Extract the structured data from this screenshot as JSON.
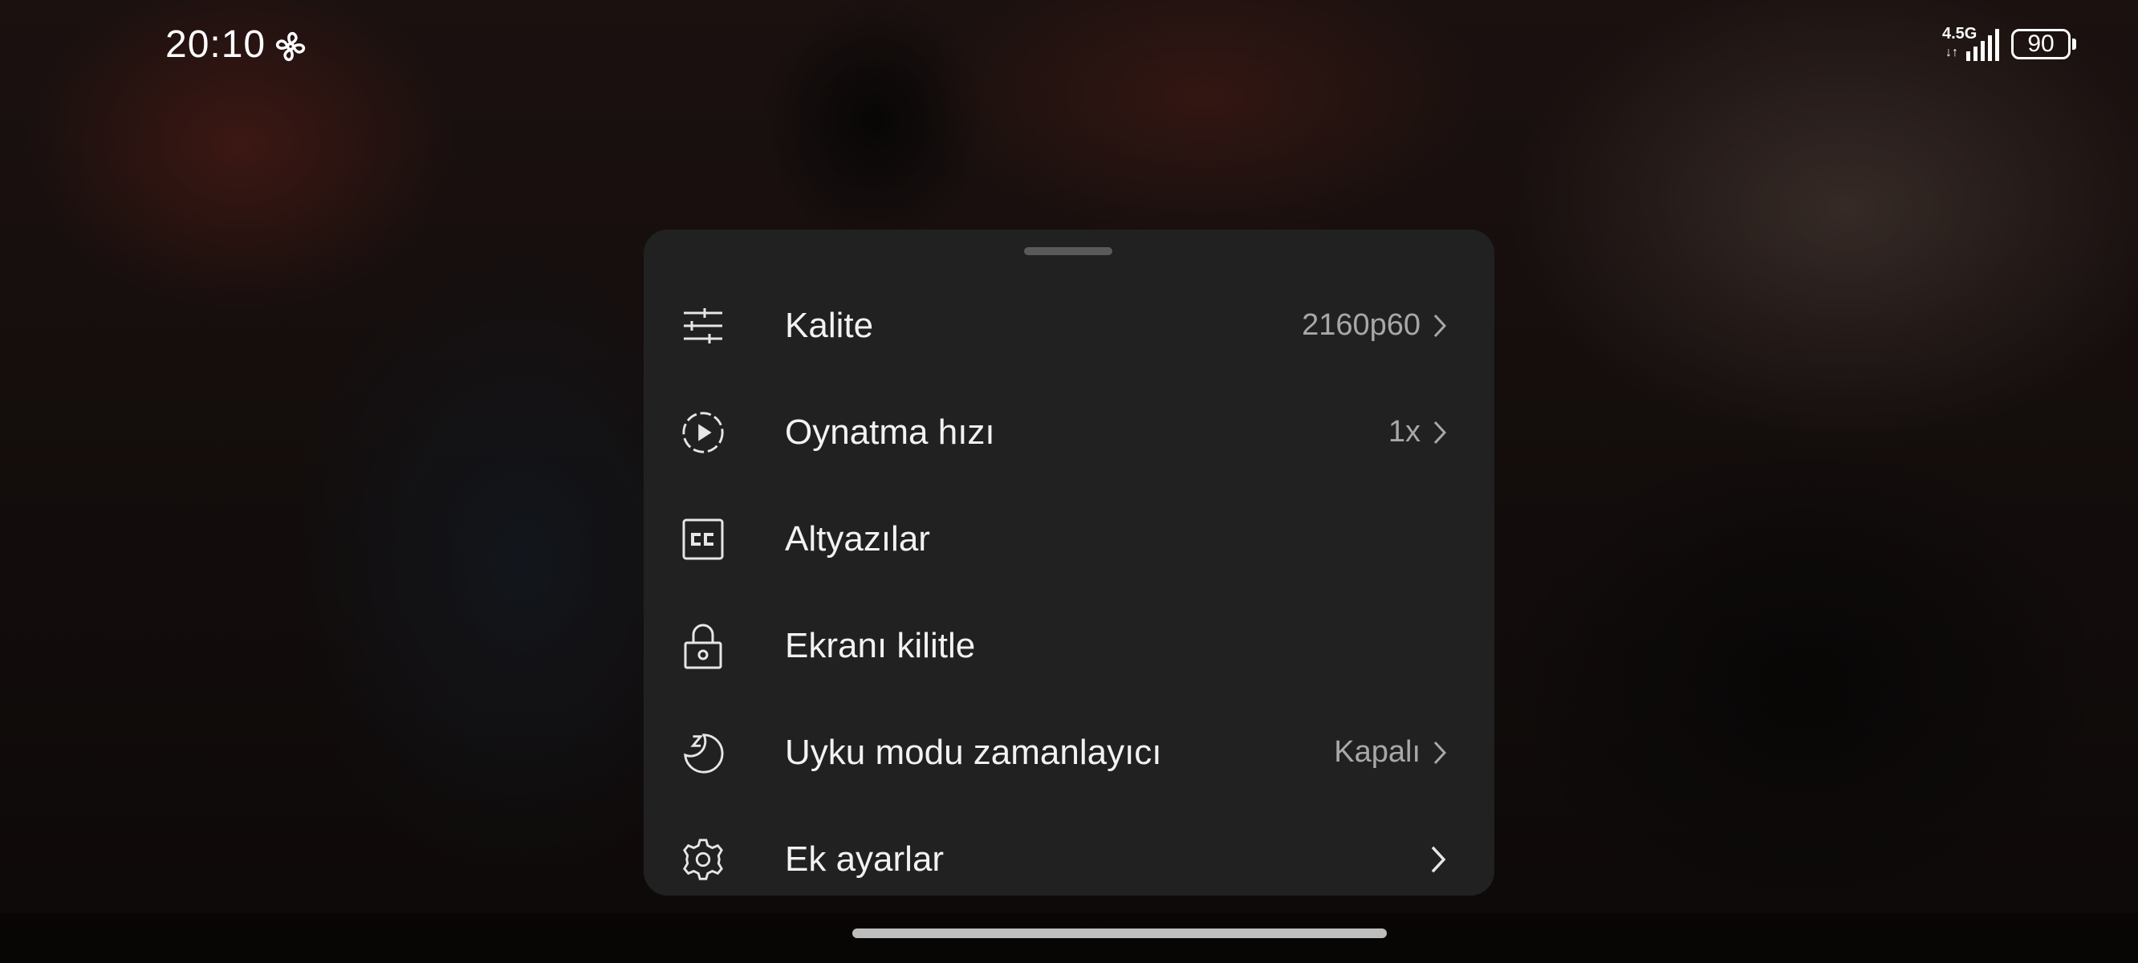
{
  "status_bar": {
    "time": "20:10",
    "network": "4.5G",
    "network_arrows": "↓↑",
    "battery": "90",
    "icons": [
      "fan-icon",
      "signal-icon",
      "battery-icon"
    ]
  },
  "menu": {
    "items": [
      {
        "icon": "sliders-icon",
        "label": "Kalite",
        "value": "2160p60",
        "chevron": true
      },
      {
        "icon": "playback-speed-icon",
        "label": "Oynatma hızı",
        "value": "1x",
        "chevron": true
      },
      {
        "icon": "closed-captions-icon",
        "label": "Altyazılar",
        "value": "",
        "chevron": false
      },
      {
        "icon": "lock-icon",
        "label": "Ekranı kilitle",
        "value": "",
        "chevron": false
      },
      {
        "icon": "sleep-timer-icon",
        "label": "Uyku modu zamanlayıcı",
        "value": "Kapalı",
        "chevron": true
      },
      {
        "icon": "gear-icon",
        "label": "Ek ayarlar",
        "value": "",
        "chevron": true
      }
    ]
  },
  "colors": {
    "sheet_bg": "#212121",
    "label": "#f2f2f2",
    "value": "#a8a8a8"
  }
}
